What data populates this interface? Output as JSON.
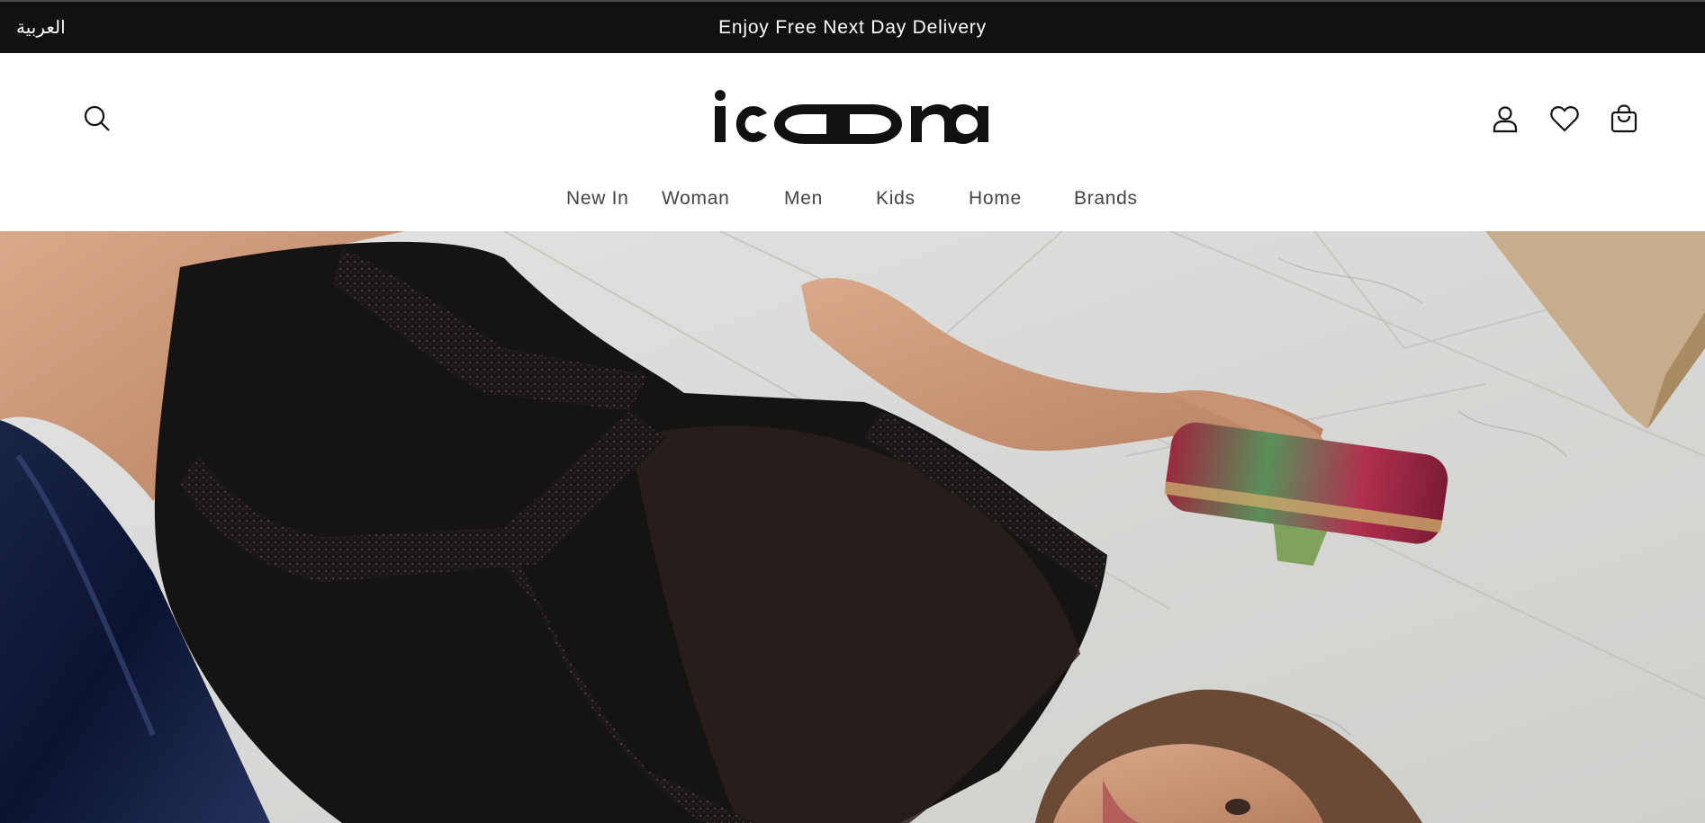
{
  "announcement": {
    "language_link": "العربية",
    "promo_text": "Enjoy Free Next Day Delivery"
  },
  "header": {
    "logo_text": "icoona",
    "icons": {
      "search": "search-icon",
      "account": "user-icon",
      "wishlist": "heart-icon",
      "cart": "shopping-bag-icon"
    }
  },
  "nav": {
    "items": [
      {
        "label": "New In"
      },
      {
        "label": "Woman"
      },
      {
        "label": "Men"
      },
      {
        "label": "Kids"
      },
      {
        "label": "Home"
      },
      {
        "label": "Brands"
      }
    ]
  },
  "hero": {
    "image": "campaign-photo"
  },
  "colors": {
    "announcement_bg": "#111111",
    "announcement_text": "#ffffff",
    "nav_text": "#444444",
    "icon_stroke": "#121212"
  }
}
